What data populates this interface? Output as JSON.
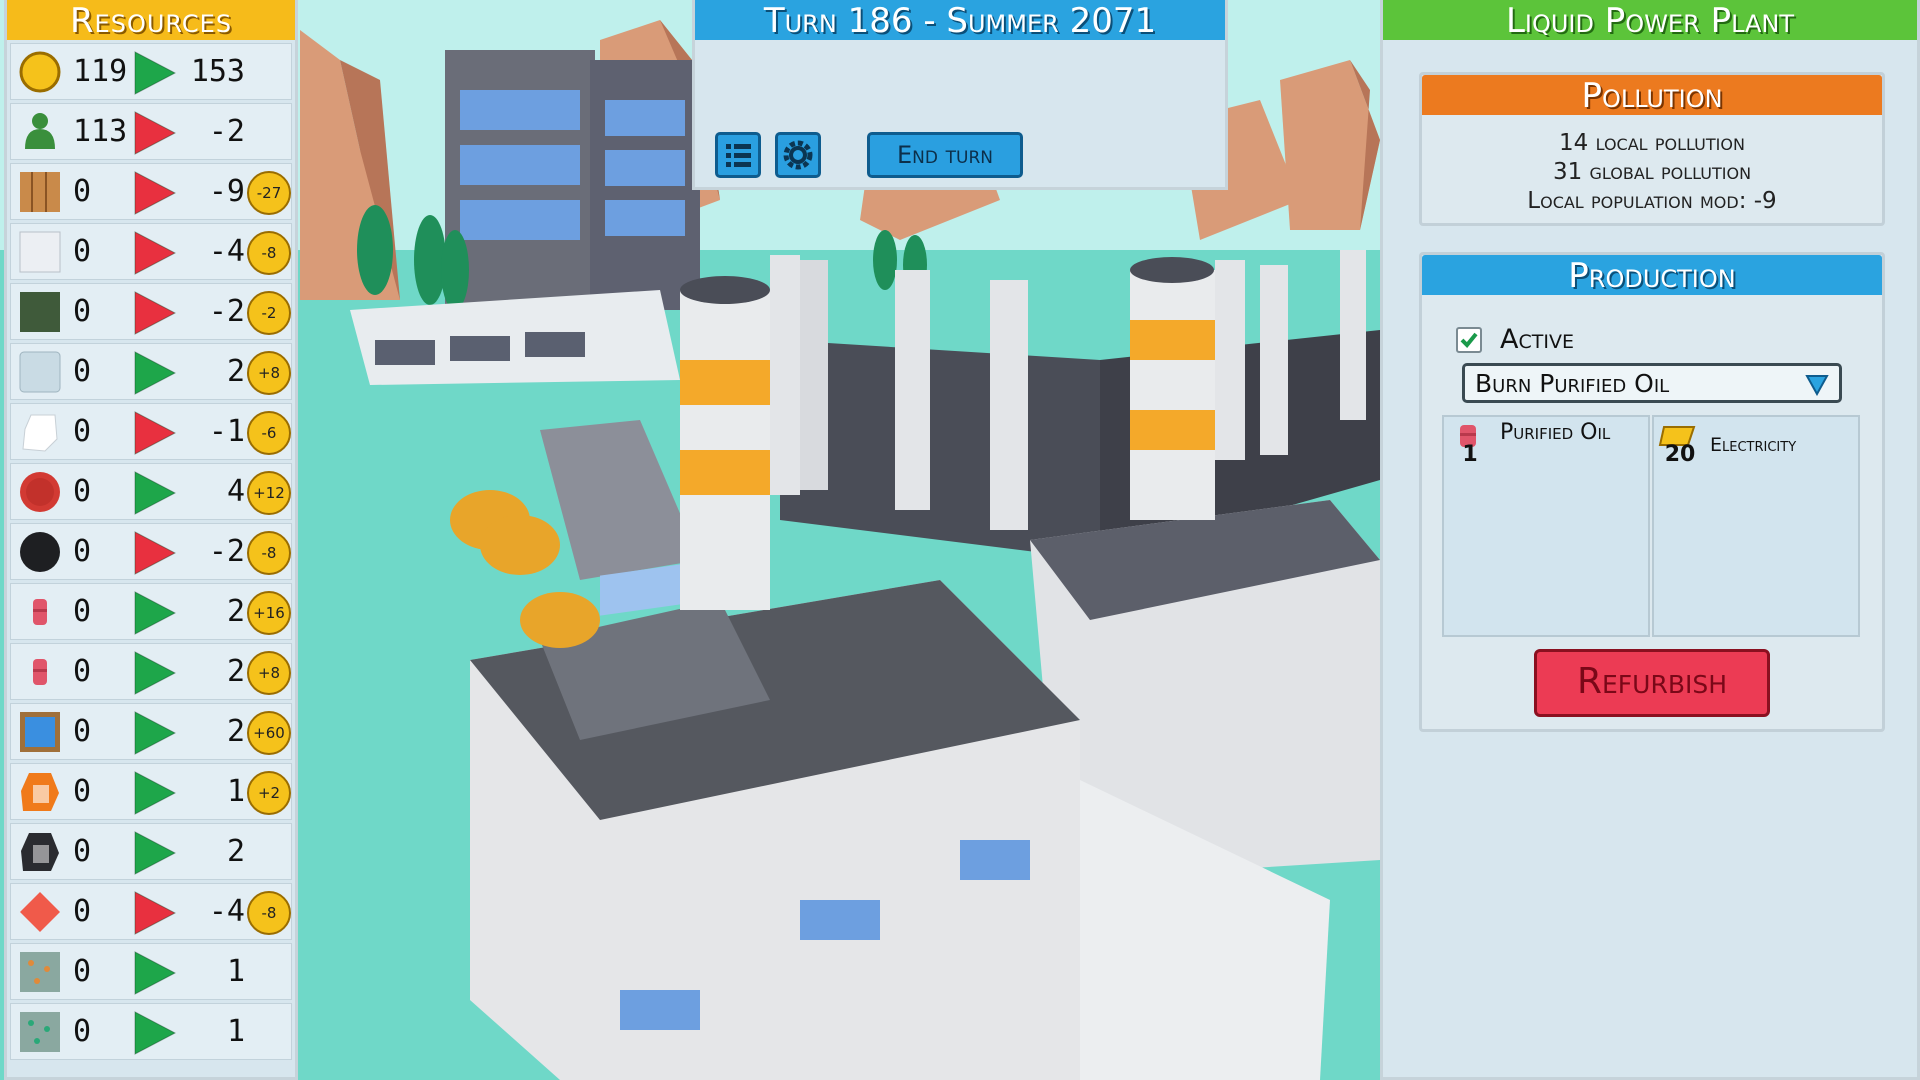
{
  "colors": {
    "resources_header": "#f6bb1a",
    "turn_header": "#2aa3e0",
    "building_header": "#5cc43a",
    "pollution_header": "#ec7a1f",
    "production_header": "#2aa3e0",
    "refurbish": "#ec3b54",
    "positive_arrow": "#1ea64a",
    "negative_arrow": "#e8303f",
    "water": "#6fd8c8"
  },
  "resources": {
    "title": "Resources",
    "rows": [
      {
        "icon": "coin-icon",
        "stock": "119",
        "trend": "up",
        "change": "153",
        "badge": ""
      },
      {
        "icon": "population-icon",
        "stock": "113",
        "trend": "down",
        "change": "-2",
        "badge": ""
      },
      {
        "icon": "wood-icon",
        "stock": "0",
        "trend": "down",
        "change": "-9",
        "badge": "-27"
      },
      {
        "icon": "white-block-icon",
        "stock": "0",
        "trend": "down",
        "change": "-4",
        "badge": "-8"
      },
      {
        "icon": "soil-icon",
        "stock": "0",
        "trend": "down",
        "change": "-2",
        "badge": "-2"
      },
      {
        "icon": "glass-icon",
        "stock": "0",
        "trend": "up",
        "change": "2",
        "badge": "+8"
      },
      {
        "icon": "white-crystal-icon",
        "stock": "0",
        "trend": "down",
        "change": "-1",
        "badge": "-6"
      },
      {
        "icon": "red-sphere-icon",
        "stock": "0",
        "trend": "up",
        "change": "4",
        "badge": "+12"
      },
      {
        "icon": "black-sphere-icon",
        "stock": "0",
        "trend": "down",
        "change": "-2",
        "badge": "-8"
      },
      {
        "icon": "oil-barrel-icon",
        "stock": "0",
        "trend": "up",
        "change": "2",
        "badge": "+16"
      },
      {
        "icon": "purified-oil-barrel-icon",
        "stock": "0",
        "trend": "up",
        "change": "2",
        "badge": "+8"
      },
      {
        "icon": "solar-panel-icon",
        "stock": "0",
        "trend": "up",
        "change": "2",
        "badge": "+60"
      },
      {
        "icon": "orange-ore-icon",
        "stock": "0",
        "trend": "up",
        "change": "1",
        "badge": "+2"
      },
      {
        "icon": "coal-ore-icon",
        "stock": "0",
        "trend": "up",
        "change": "2",
        "badge": ""
      },
      {
        "icon": "red-gem-icon",
        "stock": "0",
        "trend": "down",
        "change": "-4",
        "badge": "-8"
      },
      {
        "icon": "copper-ore-icon",
        "stock": "0",
        "trend": "up",
        "change": "1",
        "badge": ""
      },
      {
        "icon": "green-ore-icon",
        "stock": "0",
        "trend": "up",
        "change": "1",
        "badge": ""
      }
    ]
  },
  "turn": {
    "title": "Turn 186 - Summer 2071",
    "end_turn_label": "End turn"
  },
  "building": {
    "title": "Liquid Power Plant",
    "pollution": {
      "title": "Pollution",
      "local": "14 local pollution",
      "global": "31 global pollution",
      "population_mod": "Local population mod: -9"
    },
    "production": {
      "title": "Production",
      "active_label": "Active",
      "active": true,
      "recipe": "Burn Purified Oil",
      "input": {
        "qty": "1",
        "name": "Purified Oil"
      },
      "output": {
        "qty": "20",
        "name": "Electricity"
      }
    },
    "refurbish_label": "Refurbish"
  }
}
